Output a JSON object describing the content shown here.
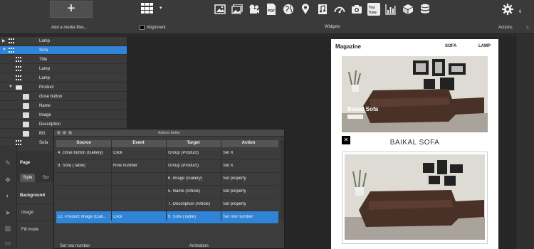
{
  "toolbar": {
    "add_icon": "+",
    "add_label": "Add a media files...",
    "alignment_label": "Alignment",
    "widgets_label": "Widgets",
    "widgets": [
      "image-icon",
      "gallery-icon",
      "video-icon",
      "pdf-icon",
      "globe-icon",
      "map-pin-icon",
      "music-icon",
      "gauge-icon",
      "camera-icon",
      "youtube-icon",
      "chart-icon",
      "cube-icon",
      "database-icon"
    ],
    "youtube_text": "You Tube",
    "pdf_text": "PDF",
    "settings_count": "6",
    "actions_label": "Actions",
    "actions_icon": "≡"
  },
  "tree": {
    "items": [
      {
        "label": "Lamp",
        "icon": "grid",
        "arrow": "▶",
        "selected": false
      },
      {
        "label": "Sofa",
        "icon": "grid",
        "arrow": "▼",
        "selected": true
      },
      {
        "label": "Title",
        "icon": "grid",
        "arrow": "",
        "selected": false
      },
      {
        "label": "Lamp",
        "icon": "grid",
        "arrow": "",
        "selected": false
      },
      {
        "label": "Lamp",
        "icon": "grid",
        "arrow": "",
        "selected": false
      },
      {
        "label": "Product",
        "icon": "folder",
        "arrow": "▼",
        "selected": false
      },
      {
        "label": "close button",
        "icon": "image",
        "arrow": "",
        "selected": false
      },
      {
        "label": "Name",
        "icon": "image",
        "arrow": "",
        "selected": false
      },
      {
        "label": "Image",
        "icon": "image",
        "arrow": "",
        "selected": false
      },
      {
        "label": "Description",
        "icon": "image",
        "arrow": "",
        "selected": false
      },
      {
        "label": "BG",
        "icon": "image",
        "arrow": "",
        "selected": false
      },
      {
        "label": "Sofa",
        "icon": "grid",
        "arrow": "",
        "selected": false
      }
    ]
  },
  "props": {
    "page_label": "Page",
    "style_tab": "Style",
    "second_tab": "Scr",
    "background_label": "Background",
    "image_label": "Image:",
    "fill_mode_label": "Fill mode"
  },
  "phone": {
    "brand": "Magazine",
    "nav_sofa": "SOFA",
    "nav_lamp": "LAMP",
    "hero_title": "Baikal Sofa",
    "close_glyph": "✕",
    "detail_title": "BAIKAL SOFA"
  },
  "dialog": {
    "title": "Actions Editor",
    "columns": [
      "Source",
      "Event",
      "Target",
      "Action"
    ],
    "rows": [
      [
        "4. close button (Gallery)",
        "Click",
        "Group (Product)",
        "Set X"
      ],
      [
        "9. Sofa (Table)",
        "Row number",
        "Group (Product)",
        "Set X"
      ],
      [
        "",
        "",
        "6. Image (Gallery)",
        "Set property"
      ],
      [
        "",
        "",
        "5. Name (Article)",
        "Set property"
      ],
      [
        "",
        "",
        "7. Description (Article)",
        "Set property"
      ],
      [
        "12. Product Image (Gall...",
        "Click",
        "9. Sofa (Table)",
        "Set row number"
      ]
    ],
    "selected_row": 5,
    "footer_left": "Set row number",
    "footer_right": "Animation"
  },
  "colors": {
    "selection": "#2f84d7",
    "toolbar": "#3a3a3a",
    "panel": "#3b3b3b",
    "canvas": "#262626"
  }
}
